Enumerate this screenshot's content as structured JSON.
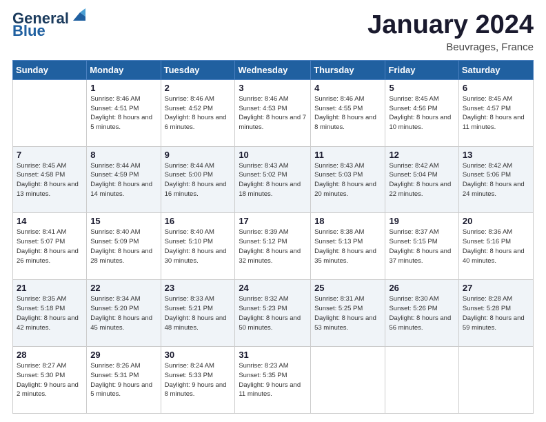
{
  "logo": {
    "line1": "General",
    "line2": "Blue"
  },
  "header": {
    "month": "January 2024",
    "location": "Beuvrages, France"
  },
  "weekdays": [
    "Sunday",
    "Monday",
    "Tuesday",
    "Wednesday",
    "Thursday",
    "Friday",
    "Saturday"
  ],
  "weeks": [
    [
      {
        "day": "",
        "sunrise": "",
        "sunset": "",
        "daylight": ""
      },
      {
        "day": "1",
        "sunrise": "Sunrise: 8:46 AM",
        "sunset": "Sunset: 4:51 PM",
        "daylight": "Daylight: 8 hours and 5 minutes."
      },
      {
        "day": "2",
        "sunrise": "Sunrise: 8:46 AM",
        "sunset": "Sunset: 4:52 PM",
        "daylight": "Daylight: 8 hours and 6 minutes."
      },
      {
        "day": "3",
        "sunrise": "Sunrise: 8:46 AM",
        "sunset": "Sunset: 4:53 PM",
        "daylight": "Daylight: 8 hours and 7 minutes."
      },
      {
        "day": "4",
        "sunrise": "Sunrise: 8:46 AM",
        "sunset": "Sunset: 4:55 PM",
        "daylight": "Daylight: 8 hours and 8 minutes."
      },
      {
        "day": "5",
        "sunrise": "Sunrise: 8:45 AM",
        "sunset": "Sunset: 4:56 PM",
        "daylight": "Daylight: 8 hours and 10 minutes."
      },
      {
        "day": "6",
        "sunrise": "Sunrise: 8:45 AM",
        "sunset": "Sunset: 4:57 PM",
        "daylight": "Daylight: 8 hours and 11 minutes."
      }
    ],
    [
      {
        "day": "7",
        "sunrise": "Sunrise: 8:45 AM",
        "sunset": "Sunset: 4:58 PM",
        "daylight": "Daylight: 8 hours and 13 minutes."
      },
      {
        "day": "8",
        "sunrise": "Sunrise: 8:44 AM",
        "sunset": "Sunset: 4:59 PM",
        "daylight": "Daylight: 8 hours and 14 minutes."
      },
      {
        "day": "9",
        "sunrise": "Sunrise: 8:44 AM",
        "sunset": "Sunset: 5:00 PM",
        "daylight": "Daylight: 8 hours and 16 minutes."
      },
      {
        "day": "10",
        "sunrise": "Sunrise: 8:43 AM",
        "sunset": "Sunset: 5:02 PM",
        "daylight": "Daylight: 8 hours and 18 minutes."
      },
      {
        "day": "11",
        "sunrise": "Sunrise: 8:43 AM",
        "sunset": "Sunset: 5:03 PM",
        "daylight": "Daylight: 8 hours and 20 minutes."
      },
      {
        "day": "12",
        "sunrise": "Sunrise: 8:42 AM",
        "sunset": "Sunset: 5:04 PM",
        "daylight": "Daylight: 8 hours and 22 minutes."
      },
      {
        "day": "13",
        "sunrise": "Sunrise: 8:42 AM",
        "sunset": "Sunset: 5:06 PM",
        "daylight": "Daylight: 8 hours and 24 minutes."
      }
    ],
    [
      {
        "day": "14",
        "sunrise": "Sunrise: 8:41 AM",
        "sunset": "Sunset: 5:07 PM",
        "daylight": "Daylight: 8 hours and 26 minutes."
      },
      {
        "day": "15",
        "sunrise": "Sunrise: 8:40 AM",
        "sunset": "Sunset: 5:09 PM",
        "daylight": "Daylight: 8 hours and 28 minutes."
      },
      {
        "day": "16",
        "sunrise": "Sunrise: 8:40 AM",
        "sunset": "Sunset: 5:10 PM",
        "daylight": "Daylight: 8 hours and 30 minutes."
      },
      {
        "day": "17",
        "sunrise": "Sunrise: 8:39 AM",
        "sunset": "Sunset: 5:12 PM",
        "daylight": "Daylight: 8 hours and 32 minutes."
      },
      {
        "day": "18",
        "sunrise": "Sunrise: 8:38 AM",
        "sunset": "Sunset: 5:13 PM",
        "daylight": "Daylight: 8 hours and 35 minutes."
      },
      {
        "day": "19",
        "sunrise": "Sunrise: 8:37 AM",
        "sunset": "Sunset: 5:15 PM",
        "daylight": "Daylight: 8 hours and 37 minutes."
      },
      {
        "day": "20",
        "sunrise": "Sunrise: 8:36 AM",
        "sunset": "Sunset: 5:16 PM",
        "daylight": "Daylight: 8 hours and 40 minutes."
      }
    ],
    [
      {
        "day": "21",
        "sunrise": "Sunrise: 8:35 AM",
        "sunset": "Sunset: 5:18 PM",
        "daylight": "Daylight: 8 hours and 42 minutes."
      },
      {
        "day": "22",
        "sunrise": "Sunrise: 8:34 AM",
        "sunset": "Sunset: 5:20 PM",
        "daylight": "Daylight: 8 hours and 45 minutes."
      },
      {
        "day": "23",
        "sunrise": "Sunrise: 8:33 AM",
        "sunset": "Sunset: 5:21 PM",
        "daylight": "Daylight: 8 hours and 48 minutes."
      },
      {
        "day": "24",
        "sunrise": "Sunrise: 8:32 AM",
        "sunset": "Sunset: 5:23 PM",
        "daylight": "Daylight: 8 hours and 50 minutes."
      },
      {
        "day": "25",
        "sunrise": "Sunrise: 8:31 AM",
        "sunset": "Sunset: 5:25 PM",
        "daylight": "Daylight: 8 hours and 53 minutes."
      },
      {
        "day": "26",
        "sunrise": "Sunrise: 8:30 AM",
        "sunset": "Sunset: 5:26 PM",
        "daylight": "Daylight: 8 hours and 56 minutes."
      },
      {
        "day": "27",
        "sunrise": "Sunrise: 8:28 AM",
        "sunset": "Sunset: 5:28 PM",
        "daylight": "Daylight: 8 hours and 59 minutes."
      }
    ],
    [
      {
        "day": "28",
        "sunrise": "Sunrise: 8:27 AM",
        "sunset": "Sunset: 5:30 PM",
        "daylight": "Daylight: 9 hours and 2 minutes."
      },
      {
        "day": "29",
        "sunrise": "Sunrise: 8:26 AM",
        "sunset": "Sunset: 5:31 PM",
        "daylight": "Daylight: 9 hours and 5 minutes."
      },
      {
        "day": "30",
        "sunrise": "Sunrise: 8:24 AM",
        "sunset": "Sunset: 5:33 PM",
        "daylight": "Daylight: 9 hours and 8 minutes."
      },
      {
        "day": "31",
        "sunrise": "Sunrise: 8:23 AM",
        "sunset": "Sunset: 5:35 PM",
        "daylight": "Daylight: 9 hours and 11 minutes."
      },
      {
        "day": "",
        "sunrise": "",
        "sunset": "",
        "daylight": ""
      },
      {
        "day": "",
        "sunrise": "",
        "sunset": "",
        "daylight": ""
      },
      {
        "day": "",
        "sunrise": "",
        "sunset": "",
        "daylight": ""
      }
    ]
  ]
}
